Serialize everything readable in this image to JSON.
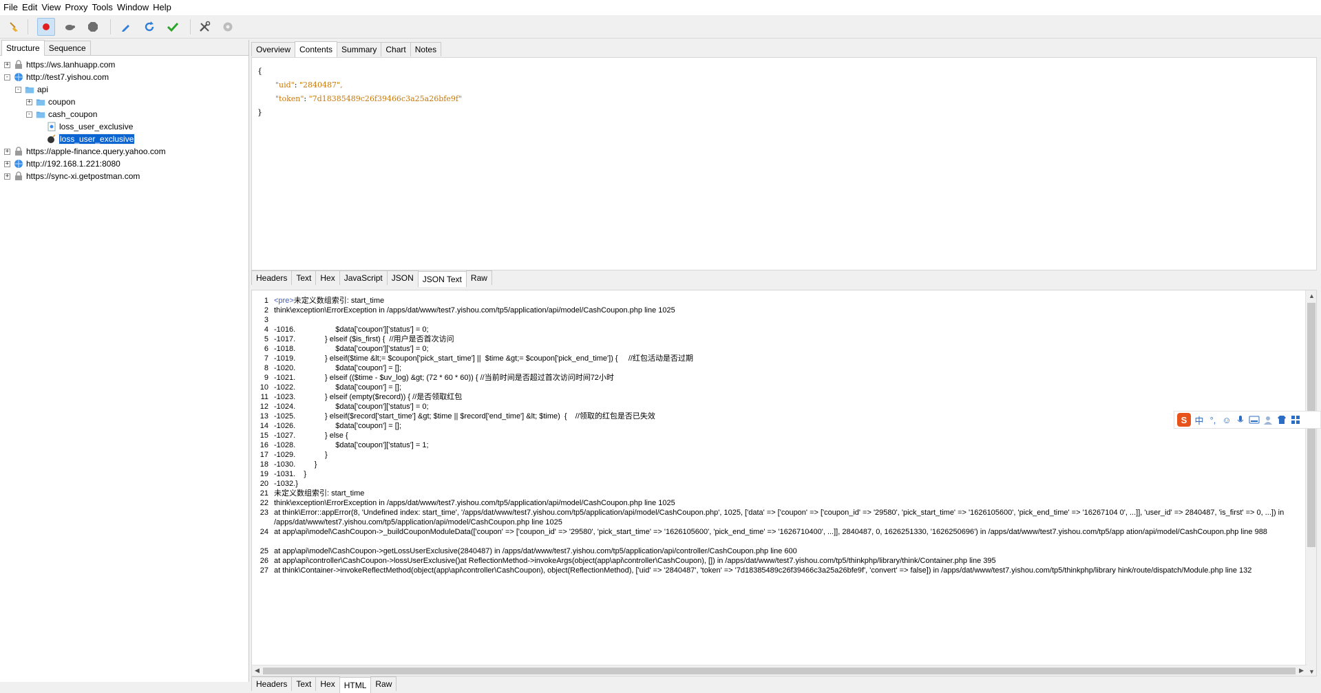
{
  "menu": [
    "File",
    "Edit",
    "View",
    "Proxy",
    "Tools",
    "Window",
    "Help"
  ],
  "left_tabs": [
    "Structure",
    "Sequence"
  ],
  "tree": [
    {
      "label": "https://ws.lanhuapp.com",
      "depth": 0,
      "expander": "+",
      "icon": "lock-icon"
    },
    {
      "label": "http://test7.yishou.com",
      "depth": 0,
      "expander": "-",
      "icon": "globe-icon"
    },
    {
      "label": "api",
      "depth": 1,
      "expander": "-",
      "icon": "folder-icon"
    },
    {
      "label": "coupon",
      "depth": 2,
      "expander": "+",
      "icon": "folder-icon"
    },
    {
      "label": "cash_coupon",
      "depth": 2,
      "expander": "-",
      "icon": "folder-icon"
    },
    {
      "label": "loss_user_exclusive",
      "depth": 3,
      "expander": "",
      "icon": "request-icon"
    },
    {
      "label": "loss_user_exclusive",
      "depth": 3,
      "expander": "",
      "icon": "bomb-icon",
      "selected": true
    },
    {
      "label": "https://apple-finance.query.yahoo.com",
      "depth": 0,
      "expander": "+",
      "icon": "lock-icon"
    },
    {
      "label": "http://192.168.1.221:8080",
      "depth": 0,
      "expander": "+",
      "icon": "globe-icon"
    },
    {
      "label": "https://sync-xi.getpostman.com",
      "depth": 0,
      "expander": "+",
      "icon": "lock-icon"
    }
  ],
  "top_tabs": [
    "Overview",
    "Contents",
    "Summary",
    "Chart",
    "Notes"
  ],
  "top_tabs_active": "Contents",
  "request_json": {
    "open": "{",
    "uid_key": "\"uid\"",
    "uid_val": "\"2840487\",",
    "token_key": "\"token\"",
    "token_val": "\"7d18385489c26f39466c3a25a26bfe9f\"",
    "close": "}"
  },
  "mid_tabs": [
    "Headers",
    "Text",
    "Hex",
    "JavaScript",
    "JSON",
    "JSON Text",
    "Raw"
  ],
  "mid_tabs_active": "JSON Text",
  "code_lines": [
    {
      "n": "1",
      "t": "未定义数组索引: start_time",
      "tag": "<pre>"
    },
    {
      "n": "2",
      "t": "think\\exception\\ErrorException in /apps/dat/www/test7.yishou.com/tp5/application/api/model/CashCoupon.php line 1025"
    },
    {
      "n": "3",
      "t": ""
    },
    {
      "n": "4",
      "t": "-1016.                   $data['coupon']['status'] = 0;"
    },
    {
      "n": "5",
      "t": "-1017.              } elseif ($is_first) {  //用户是否首次访问"
    },
    {
      "n": "6",
      "t": "-1018.                   $data['coupon']['status'] = 0;"
    },
    {
      "n": "7",
      "t": "-1019.              } elseif($time &lt;= $coupon['pick_start_time'] ||  $time &gt;= $coupon['pick_end_time']) {     //红包活动是否过期"
    },
    {
      "n": "8",
      "t": "-1020.                   $data['coupon'] = [];"
    },
    {
      "n": "9",
      "t": "-1021.              } elseif (($time - $uv_log) &gt; (72 * 60 * 60)) { //当前时间是否超过首次访问时间72小时"
    },
    {
      "n": "10",
      "t": "-1022.                   $data['coupon'] = [];"
    },
    {
      "n": "11",
      "t": "-1023.              } elseif (empty($record)) { //是否领取红包"
    },
    {
      "n": "12",
      "t": "-1024.                   $data['coupon']['status'] = 0;"
    },
    {
      "n": "13",
      "t": "-1025.              } elseif($record['start_time'] &gt; $time || $record['end_time'] &lt; $time)  {    //领取的红包是否已失效"
    },
    {
      "n": "14",
      "t": "-1026.                   $data['coupon'] = [];"
    },
    {
      "n": "15",
      "t": "-1027.              } else {"
    },
    {
      "n": "16",
      "t": "-1028.                   $data['coupon']['status'] = 1;"
    },
    {
      "n": "17",
      "t": "-1029.              }"
    },
    {
      "n": "18",
      "t": "-1030.         }"
    },
    {
      "n": "19",
      "t": "-1031.    }"
    },
    {
      "n": "20",
      "t": "-1032.}"
    },
    {
      "n": "21",
      "t": "未定义数组索引: start_time"
    },
    {
      "n": "22",
      "t": "think\\exception\\ErrorException in /apps/dat/www/test7.yishou.com/tp5/application/api/model/CashCoupon.php line 1025"
    },
    {
      "n": "23",
      "t": "at think\\Error::appError(8, 'Undefined index: start_time', '/apps/dat/www/test7.yishou.com/tp5/application/api/model/CashCoupon.php', 1025, ['data' => ['coupon' => ['coupon_id' => '29580', 'pick_start_time' => '1626105600', 'pick_end_time' => '16267104 0', ...]], 'user_id' => 2840487, 'is_first' => 0, ...]) in /apps/dat/www/test7.yishou.com/tp5/application/api/model/CashCoupon.php line 1025",
      "wrap": true
    },
    {
      "n": "24",
      "t": "at app\\api\\model\\CashCoupon->_buildCouponModuleData(['coupon' => ['coupon_id' => '29580', 'pick_start_time' => '1626105600', 'pick_end_time' => '1626710400', ...]], 2840487, 0, 1626251330, '1626250696') in /apps/dat/www/test7.yishou.com/tp5/app ation/api/model/CashCoupon.php line 988",
      "wrap": true
    },
    {
      "n": "25",
      "t": "at app\\api\\model\\CashCoupon->getLossUserExclusive(2840487) in /apps/dat/www/test7.yishou.com/tp5/application/api/controller/CashCoupon.php line 600"
    },
    {
      "n": "26",
      "t": "at app\\api\\controller\\CashCoupon->lossUserExclusive()at ReflectionMethod->invokeArgs(object(app\\api\\controller\\CashCoupon), []) in /apps/dat/www/test7.yishou.com/tp5/thinkphp/library/think/Container.php line 395"
    },
    {
      "n": "27",
      "t": "at think\\Container->invokeReflectMethod(object(app\\api\\controller\\CashCoupon), object(ReflectionMethod), ['uid' => '2840487', 'token' => '7d18385489c26f39466c3a25a26bfe9f', 'convert' => false]) in /apps/dat/www/test7.yishou.com/tp5/thinkphp/library hink/route/dispatch/Module.php line 132",
      "wrap": true
    }
  ],
  "bottom_tabs": [
    "Headers",
    "Text",
    "Hex",
    "HTML",
    "Raw"
  ],
  "bottom_tabs_active": "HTML",
  "ime": {
    "logo": "S",
    "lang": "中",
    "punct": "°,"
  },
  "colors": {
    "accent": "#0a64d2",
    "json": "#c8780a",
    "record": "#e02020"
  }
}
